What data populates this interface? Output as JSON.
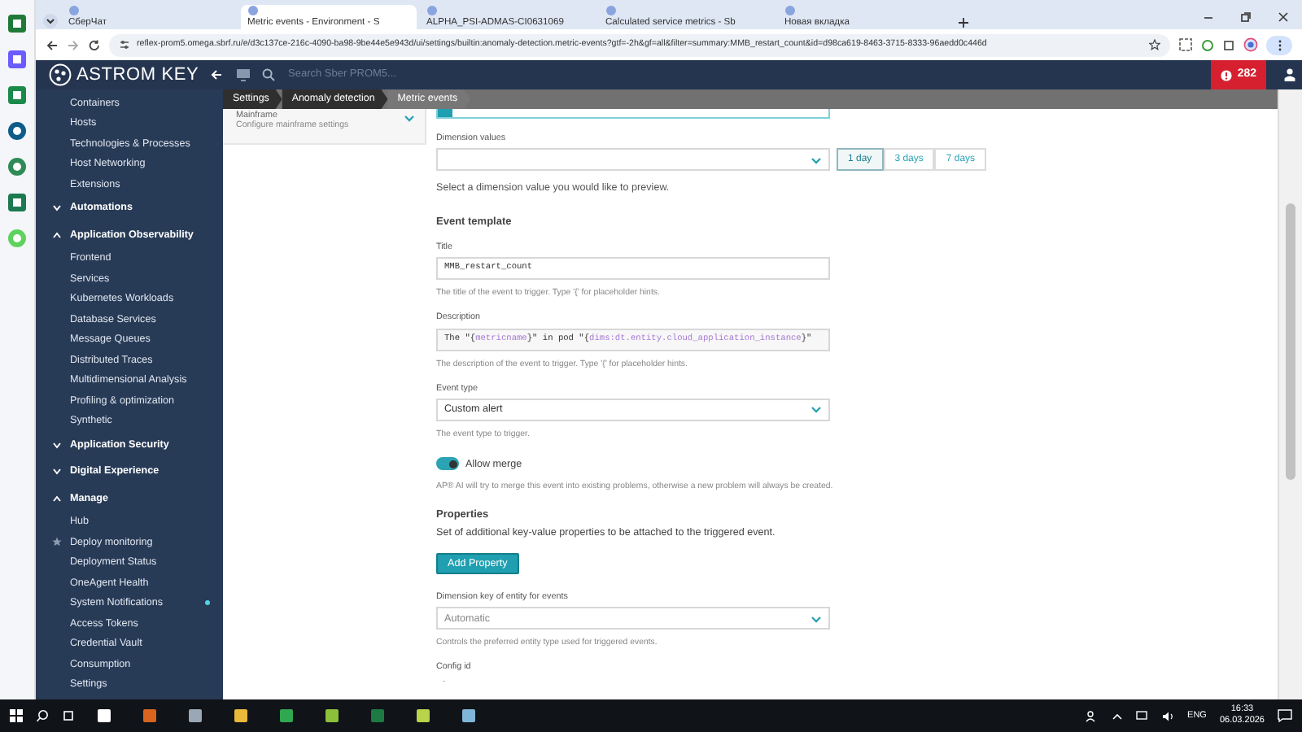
{
  "browser": {
    "tabs": [
      {
        "label": "СберЧат",
        "selected": false
      },
      {
        "label": "Metric events - Environment - S",
        "selected": true
      },
      {
        "label": "ALPHA_PSI-ADMAS-CI0631069",
        "selected": false
      },
      {
        "label": "Calculated service metrics - Sb",
        "selected": false
      },
      {
        "label": "Новая вкладка",
        "selected": false
      }
    ],
    "url": "reflex-prom5.omega.sbrf.ru/e/d3c137ce-216c-4090-ba98-9be44e5e943d/ui/settings/builtin:anomaly-detection.metric-events?gtf=-2h&gf=all&filter=summary:MMB_restart_count&id=d98ca619-8463-3715-8333-96aedd0c446d"
  },
  "header": {
    "logo": "ASTROM KEY",
    "search_placeholder": "Search Sber PROM5...",
    "problems_count": "282"
  },
  "sidebar": {
    "items": [
      {
        "kind": "link",
        "label": "Containers"
      },
      {
        "kind": "link",
        "label": "Hosts"
      },
      {
        "kind": "link",
        "label": "Technologies & Processes"
      },
      {
        "kind": "link",
        "label": "Host Networking"
      },
      {
        "kind": "link",
        "label": "Extensions"
      },
      {
        "kind": "group",
        "label": "Automations",
        "expanded": false
      },
      {
        "kind": "group",
        "label": "Application Observability",
        "expanded": true,
        "children": [
          {
            "label": "Frontend",
            "starred": false,
            "notification": false
          },
          {
            "label": "Services",
            "starred": false,
            "notification": false
          },
          {
            "label": "Kubernetes Workloads",
            "starred": false,
            "notification": false
          },
          {
            "label": "Database Services",
            "starred": false,
            "notification": false
          },
          {
            "label": "Message Queues",
            "starred": false,
            "notification": false
          },
          {
            "label": "Distributed Traces",
            "starred": false,
            "notification": false
          },
          {
            "label": "Multidimensional Analysis",
            "starred": false,
            "notification": false
          },
          {
            "label": "Profiling & optimization",
            "starred": false,
            "notification": false
          },
          {
            "label": "Synthetic",
            "starred": false,
            "notification": false
          }
        ]
      },
      {
        "kind": "group",
        "label": "Application Security",
        "expanded": false
      },
      {
        "kind": "group",
        "label": "Digital Experience",
        "expanded": false
      },
      {
        "kind": "group",
        "label": "Manage",
        "expanded": true,
        "children": [
          {
            "label": "Hub",
            "starred": false,
            "notification": false
          },
          {
            "label": "Deploy monitoring",
            "starred": true,
            "notification": false
          },
          {
            "label": "Deployment Status",
            "starred": false,
            "notification": false
          },
          {
            "label": "OneAgent Health",
            "starred": false,
            "notification": false
          },
          {
            "label": "System Notifications",
            "starred": false,
            "notification": true
          },
          {
            "label": "Access Tokens",
            "starred": false,
            "notification": false
          },
          {
            "label": "Credential Vault",
            "starred": false,
            "notification": false
          },
          {
            "label": "Consumption",
            "starred": false,
            "notification": false
          },
          {
            "label": "Settings",
            "starred": false,
            "notification": false
          }
        ]
      }
    ]
  },
  "breadcrumb": [
    "Settings",
    "Anomaly detection",
    "Metric events"
  ],
  "subpanel": {
    "title": "Mainframe",
    "description": "Configure mainframe settings",
    "expanded": false
  },
  "form": {
    "dimension_values": {
      "label": "Dimension values",
      "ranges": [
        {
          "label": "1 day",
          "selected": true
        },
        {
          "label": "3 days",
          "selected": false
        },
        {
          "label": "7 days",
          "selected": false
        }
      ],
      "hint": "Select a dimension value you would like to preview."
    },
    "section_title": "Event template",
    "title": {
      "label": "Title",
      "value": "MMB_restart_count",
      "help": "The title of the event to trigger. Type '{' for placeholder hints."
    },
    "description": {
      "label": "Description",
      "segments": [
        {
          "kind": "plain",
          "text": "The \"{"
        },
        {
          "kind": "placeholder",
          "text": "metricname"
        },
        {
          "kind": "plain",
          "text": "}\" in pod \"{"
        },
        {
          "kind": "placeholder",
          "text": "dims:dt.entity.cloud_application_instance"
        },
        {
          "kind": "plain",
          "text": "}\""
        }
      ],
      "help": "The description of the event to trigger. Type '{' for placeholder hints."
    },
    "event_type": {
      "label": "Event type",
      "value": "Custom alert",
      "help": "The event type to trigger."
    },
    "allow_merge": {
      "label": "Allow merge",
      "on": true,
      "help": "AP® AI will try to merge this event into existing problems, otherwise a new problem will always be created."
    },
    "properties": {
      "title": "Properties",
      "description": "Set of additional key-value properties to be attached to the triggered event.",
      "button": "Add Property"
    },
    "dimension_key": {
      "label": "Dimension key of entity for events",
      "placeholder": "Automatic",
      "help": "Controls the preferred entity type used for triggered events."
    },
    "config_id": {
      "label": "Config id",
      "value": "-"
    }
  },
  "taskbar": {
    "language": "ENG",
    "time": "16:33",
    "date": "06.03.2026"
  }
}
